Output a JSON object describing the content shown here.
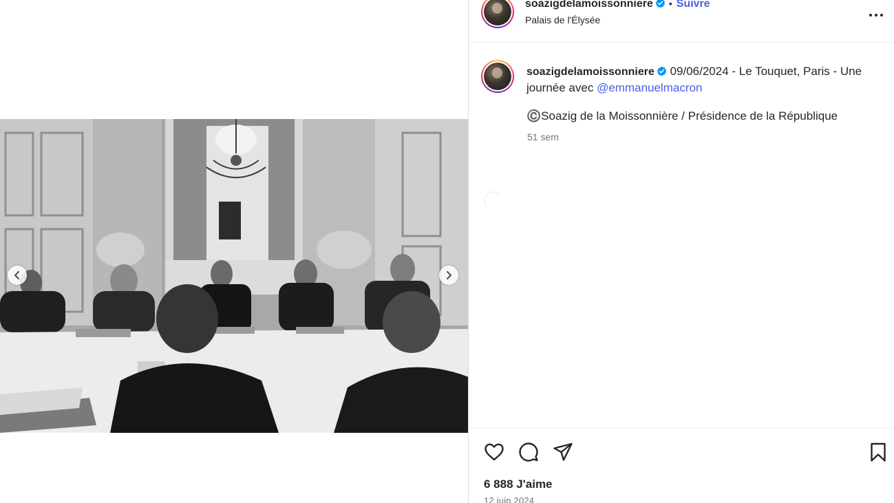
{
  "post": {
    "username": "soazigdelamoissonniere",
    "follow_label": "Suivre",
    "separator": "•",
    "location": "Palais de l'Élysée",
    "caption": {
      "username": "soazigdelamoissonniere",
      "text": "09/06/2024 - Le Touquet, Paris - Une journée avec",
      "mention": "@emmanuelmacron",
      "credit": "©️Soazig de la Moissonnière / Présidence de la République",
      "time_ago": "51 sem"
    },
    "likes": "6 888 J'aime",
    "date": "12 juin 2024"
  },
  "icons": {
    "verified": "verified-badge-icon",
    "more": "more-options-icon",
    "like": "heart-icon",
    "comment": "comment-icon",
    "share": "send-icon",
    "save": "bookmark-icon",
    "prev": "chevron-left-icon",
    "next": "chevron-right-icon"
  },
  "colors": {
    "link": "#4a5ee8",
    "verified": "#0095f6",
    "muted": "#737373",
    "text": "#262626"
  }
}
